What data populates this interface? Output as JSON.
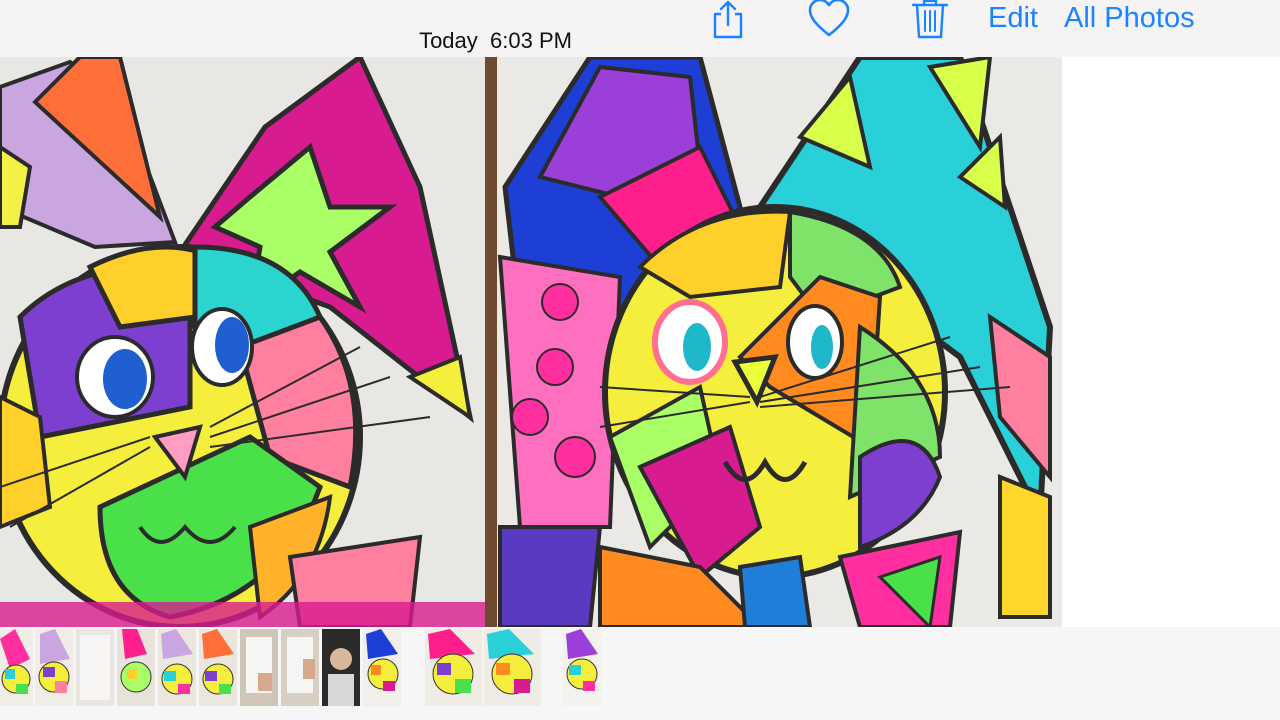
{
  "header": {
    "date_label": "Today",
    "time_label": "6:03 PM",
    "edit_label": "Edit",
    "all_photos_label": "All Photos",
    "icons": [
      "share-icon",
      "heart-icon",
      "trash-icon"
    ]
  },
  "colors": {
    "accent": "#1a84ff",
    "bar_bg": "#f5f3f4"
  },
  "thumbnails": [
    {
      "kind": "artwork"
    },
    {
      "kind": "artwork"
    },
    {
      "kind": "blank-paper"
    },
    {
      "kind": "artwork"
    },
    {
      "kind": "artwork"
    },
    {
      "kind": "artwork"
    },
    {
      "kind": "drawing-hands"
    },
    {
      "kind": "drawing-hands"
    },
    {
      "kind": "portrait"
    },
    {
      "kind": "artwork"
    },
    {
      "kind": "artwork-selected"
    },
    {
      "kind": "artwork-selected"
    },
    {
      "kind": "artwork"
    }
  ]
}
